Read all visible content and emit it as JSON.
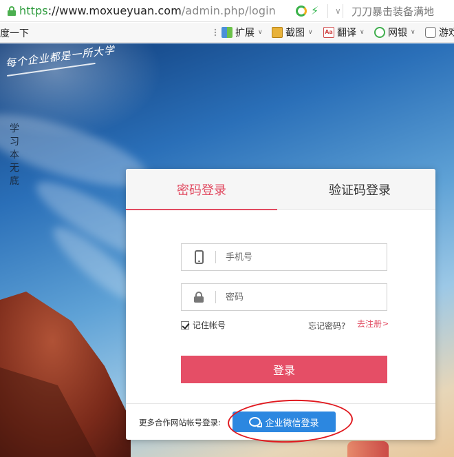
{
  "browser": {
    "url_scheme": "https",
    "url_host": "://www.moxueyuan.com",
    "url_path": "/admin.php/login",
    "news_text": "刀刀暴击装备满地",
    "bookmarks_left": "度一下",
    "bookmarks": [
      {
        "label": "扩展",
        "icon": "extensions-icon"
      },
      {
        "label": "截图",
        "icon": "screenshot-icon"
      },
      {
        "label": "翻译",
        "icon": "translate-icon"
      },
      {
        "label": "网银",
        "icon": "bank-icon"
      },
      {
        "label": "游戏",
        "icon": "game-icon"
      }
    ]
  },
  "background": {
    "slogan": "每个企业都是一所大学",
    "vertical_text": [
      "学",
      "习",
      "本",
      "无",
      "底"
    ]
  },
  "login": {
    "tabs": [
      {
        "label": "密码登录",
        "active": true
      },
      {
        "label": "验证码登录",
        "active": false
      }
    ],
    "phone_placeholder": "手机号",
    "password_placeholder": "密码",
    "remember_label": "记住帐号",
    "remember_checked": true,
    "forgot_label": "忘记密码?",
    "register_label": "去注册",
    "register_arrow": ">",
    "submit_label": "登录",
    "partner_label": "更多合作网站帐号登录:",
    "wechat_label": "企业微信登录"
  },
  "colors": {
    "accent": "#e54e66",
    "wechat_blue": "#2c87e0",
    "annotation_red": "#e0191f",
    "secure_green": "#2a9a3a"
  }
}
